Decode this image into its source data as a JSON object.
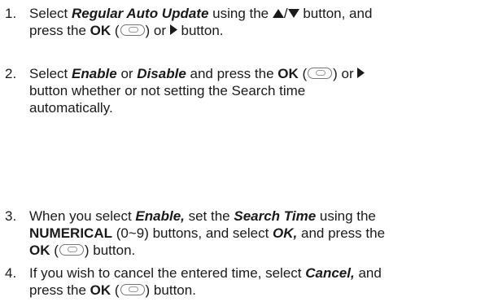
{
  "steps": [
    {
      "number": "1.",
      "parts": {
        "p1": "Select ",
        "em1": "Regular Auto Update",
        "p2": " using the ",
        "p3": " button, and",
        "p4": "press the ",
        "ok": "OK",
        "p5": " (",
        "p6": ") or ",
        "p7": " button."
      }
    },
    {
      "number": "2.",
      "parts": {
        "p1": "Select ",
        "em1": "Enable",
        "p2": " or ",
        "em2": "Disable",
        "p3": " and press the ",
        "ok": "OK",
        "p4": " (",
        "p5": ") or ",
        "line2": "button whether or not setting the Search time",
        "line3": "automatically."
      }
    },
    {
      "number": "3.",
      "parts": {
        "p1": "When you select ",
        "em1": "Enable,",
        "p2": " set the ",
        "em2": "Search Time",
        "p3": " using the",
        "b1": "NUMERICAL",
        "p4": " (0~9) buttons, and select ",
        "em3": "OK,",
        "p5": " and press the",
        "ok": "OK",
        "p6": " (",
        "p7": ") button."
      }
    },
    {
      "number": "4.",
      "parts": {
        "p1": "If you wish to cancel the entered time, select ",
        "em1": "Cancel,",
        "p2": " and",
        "p3": "press the ",
        "ok": "OK",
        "p4": " (",
        "p5": ") button."
      }
    }
  ],
  "icons": {
    "up_down": "up-down-arrow-icon",
    "right": "right-arrow-icon",
    "ok": "ok-button-icon"
  },
  "separator": "/"
}
